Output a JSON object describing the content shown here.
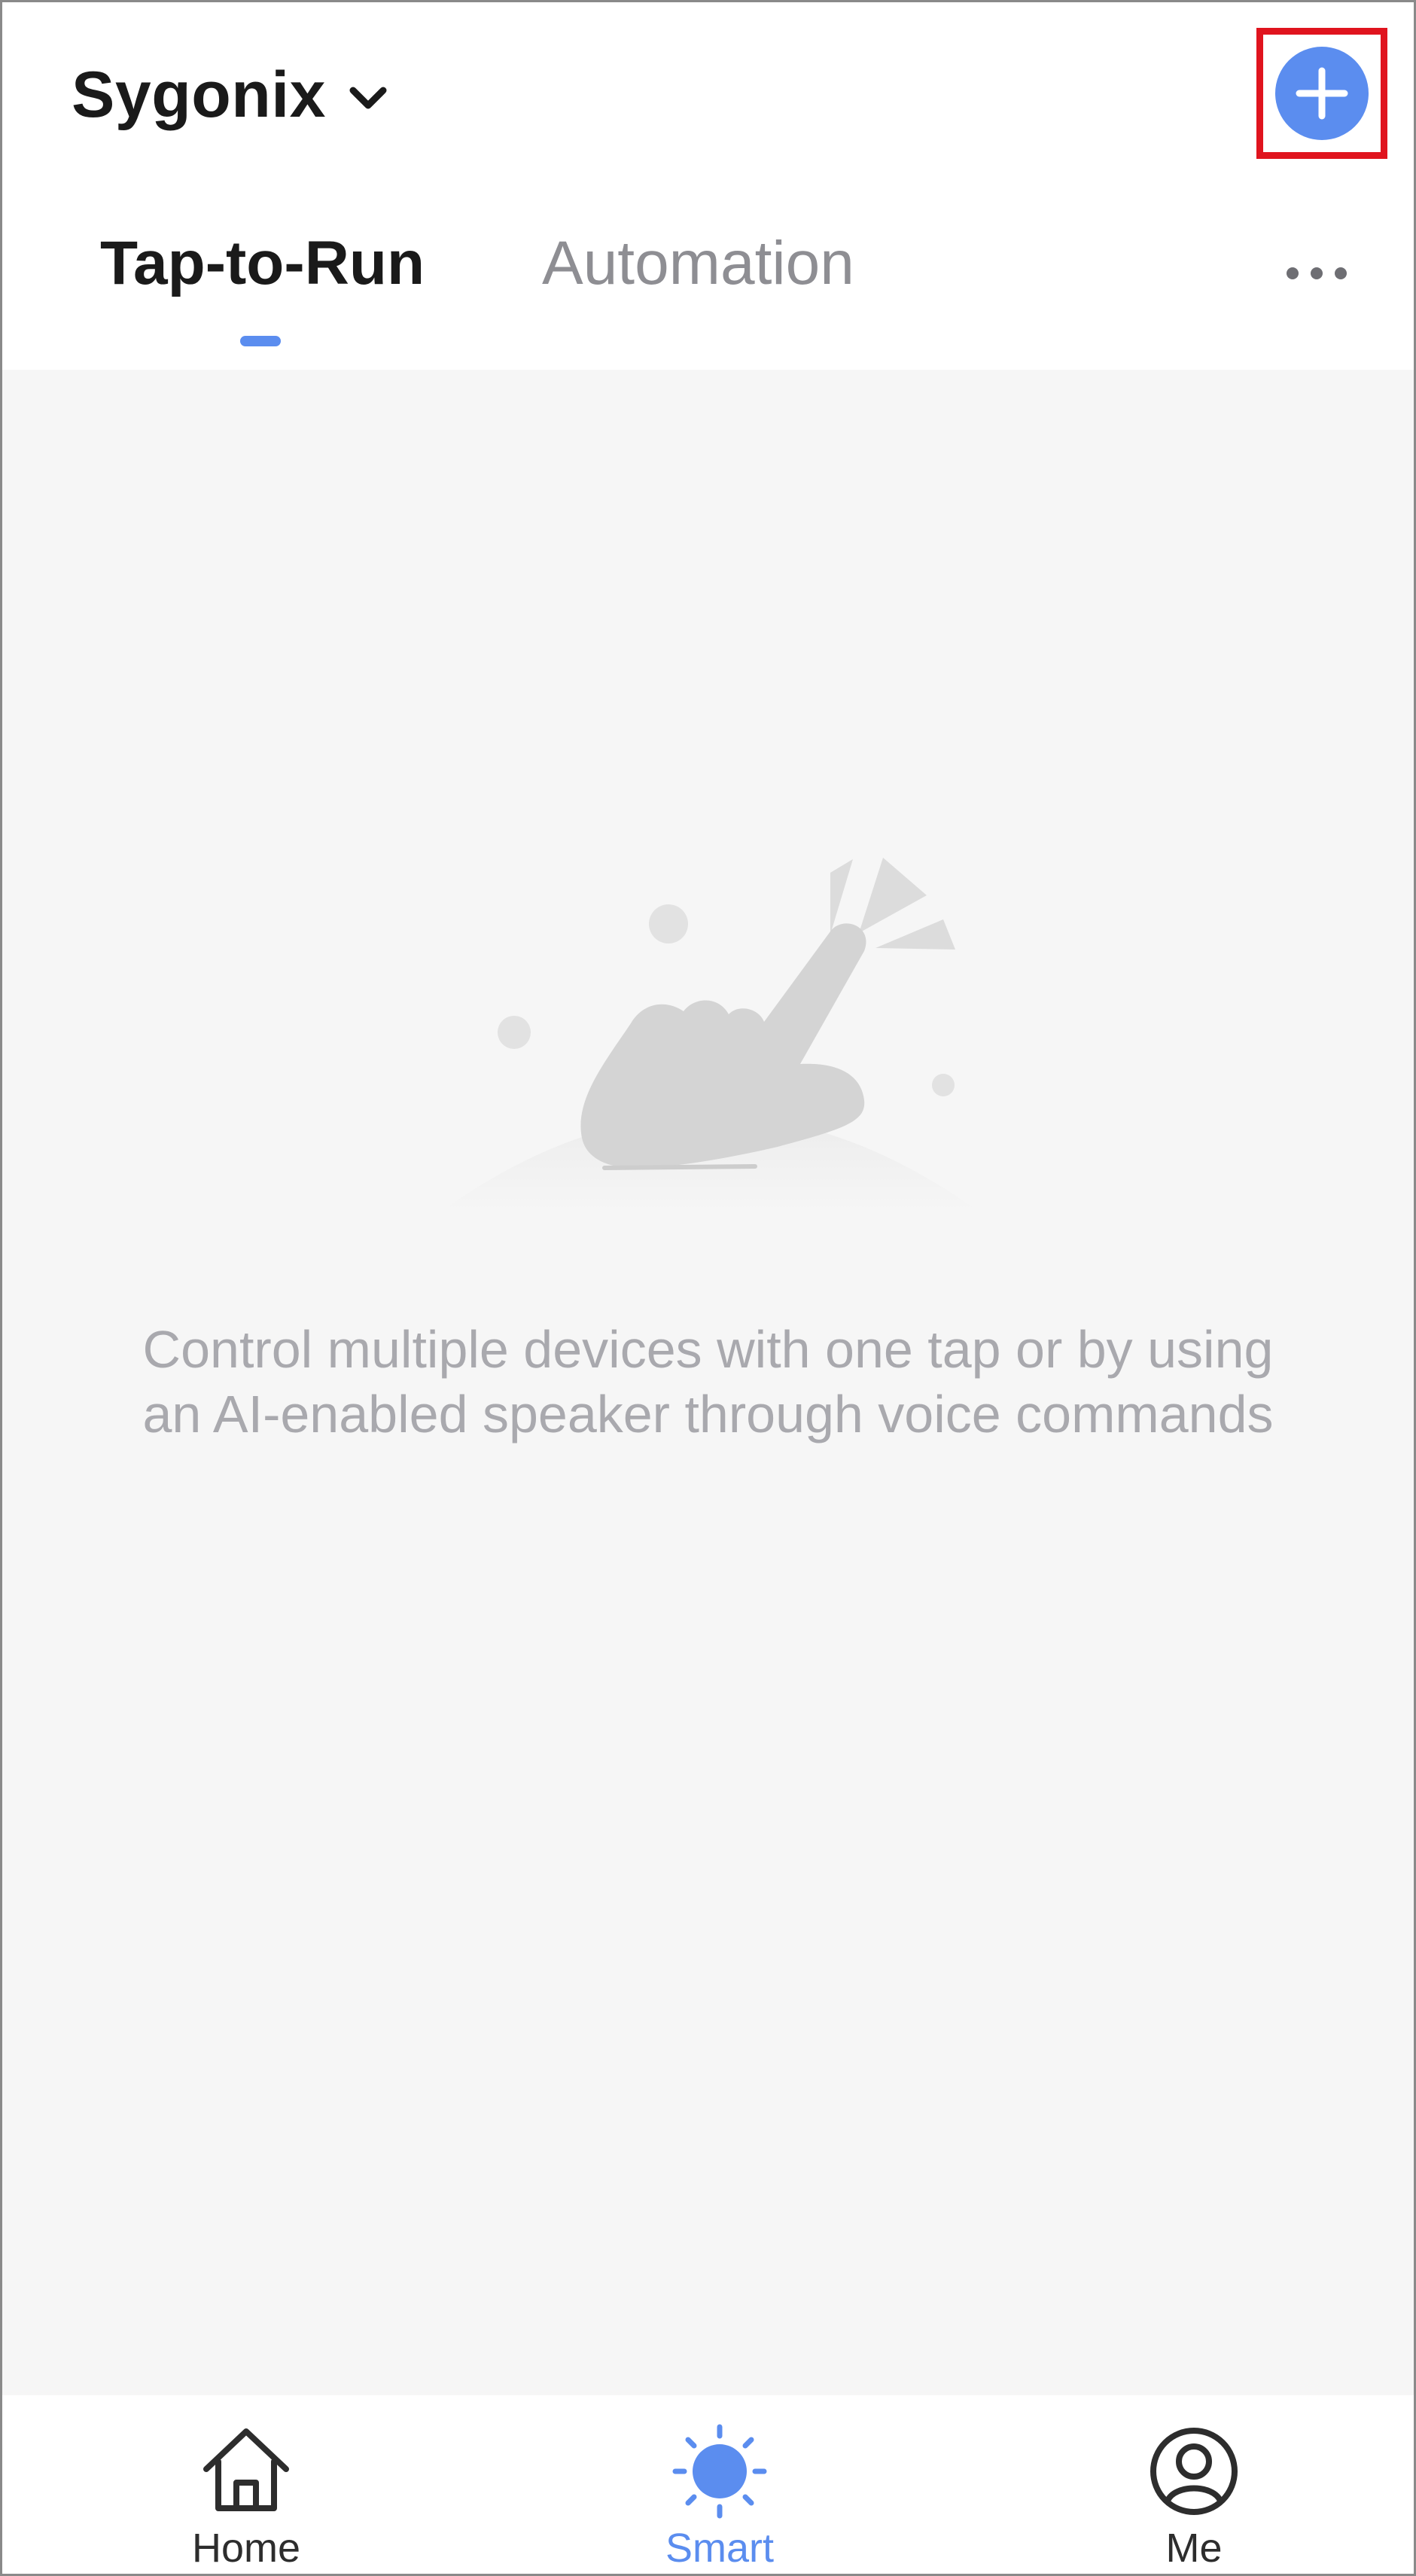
{
  "header": {
    "home_name": "Sygonix",
    "dropdown_icon": "chevron-down-icon",
    "add_icon": "plus-circle-icon"
  },
  "tabs": [
    {
      "label": "Tap-to-Run",
      "active": true
    },
    {
      "label": "Automation",
      "active": false
    }
  ],
  "more_icon": "more-horizontal-icon",
  "empty_state": {
    "illustration": "tap-hand-illustration",
    "line1": "Control multiple devices with one tap or by using",
    "line2": "an AI-enabled speaker through voice commands"
  },
  "bottom_nav": [
    {
      "label": "Home",
      "icon": "home-icon",
      "active": false
    },
    {
      "label": "Smart",
      "icon": "smart-sun-icon",
      "active": true
    },
    {
      "label": "Me",
      "icon": "profile-icon",
      "active": false
    }
  ],
  "colors": {
    "accent": "#5b8def",
    "highlight_border": "#e0141e",
    "content_bg": "#f6f6f6",
    "muted_text": "#a9a9ae"
  }
}
